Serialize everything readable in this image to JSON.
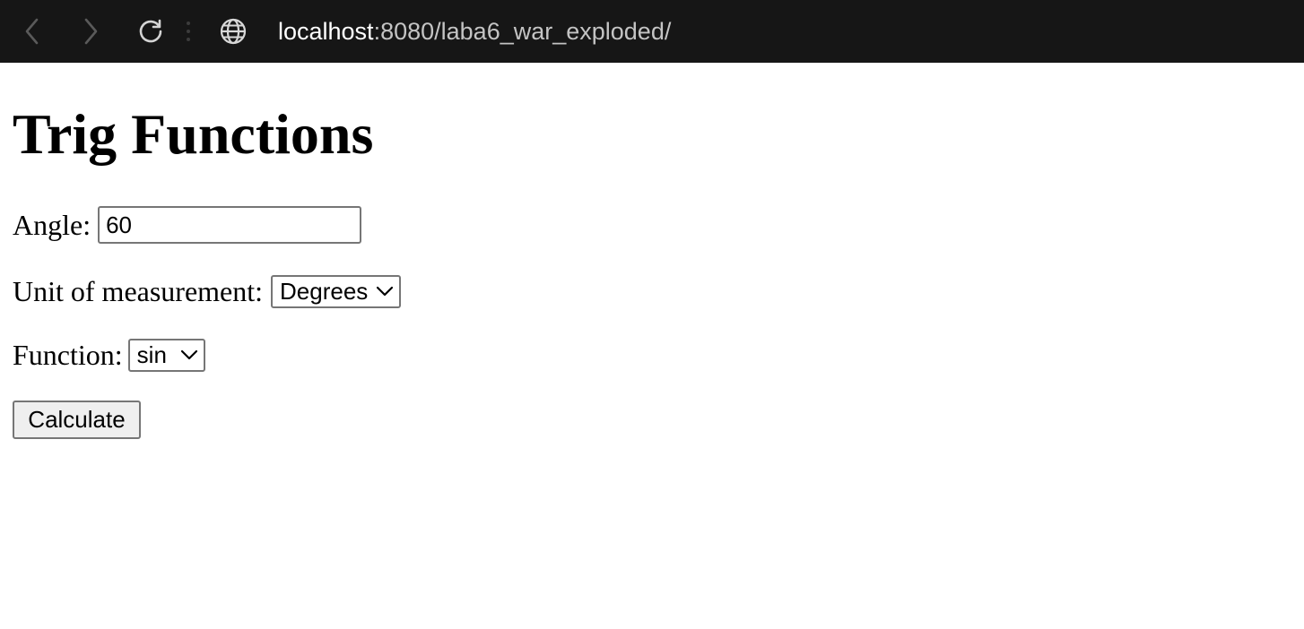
{
  "browser": {
    "address": {
      "host": "localhost",
      "path": ":8080/laba6_war_exploded/"
    },
    "icons": {
      "back": "chevron-left-icon",
      "forward": "chevron-right-icon",
      "reload": "reload-icon",
      "menu": "vertical-dots-icon",
      "site": "globe-icon"
    },
    "colors": {
      "toolbar_background": "#161616",
      "url_host": "#ffffff",
      "url_path": "#c4c4c4"
    }
  },
  "page": {
    "title": "Trig Functions",
    "form": {
      "angle": {
        "label": "Angle:",
        "value": "60"
      },
      "unit": {
        "label": "Unit of measurement:",
        "selected": "Degrees"
      },
      "function": {
        "label": "Function:",
        "selected": "sin"
      },
      "submit_label": "Calculate"
    }
  }
}
